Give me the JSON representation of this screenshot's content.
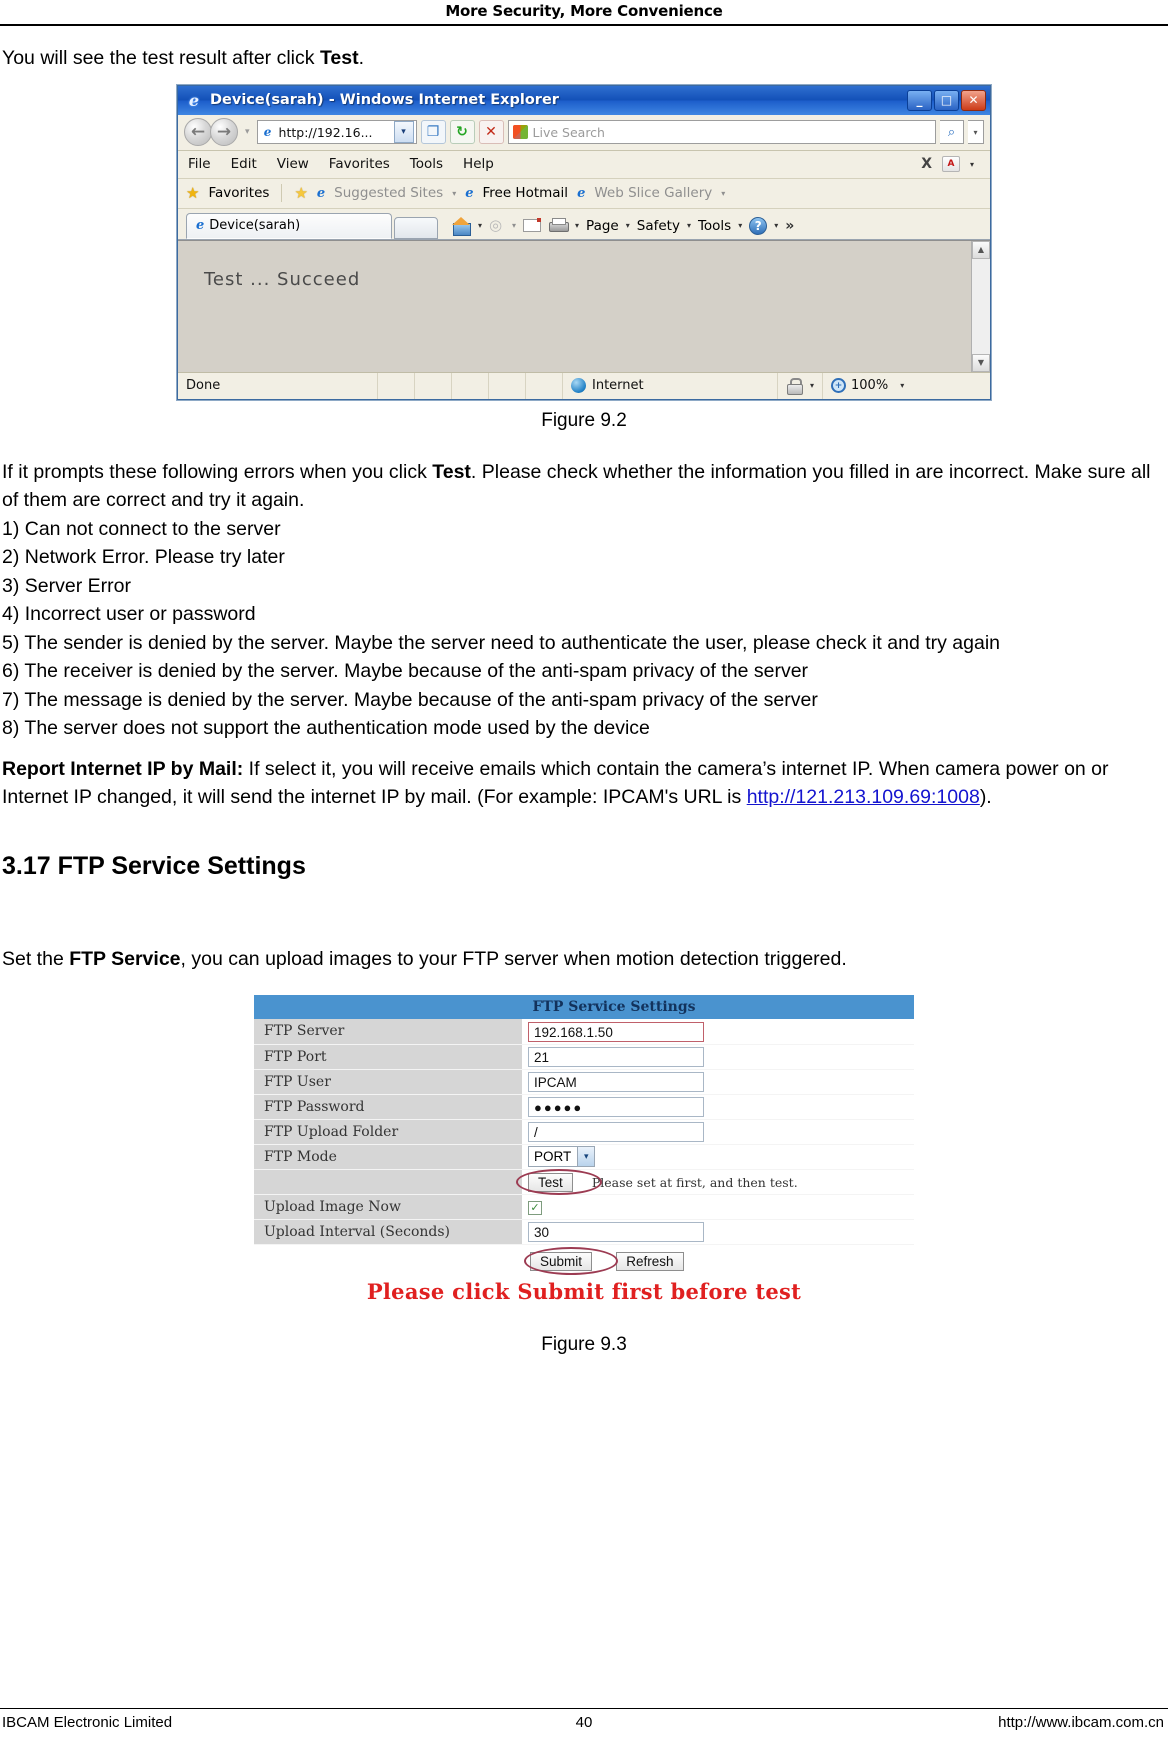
{
  "header": {
    "title": "More Security, More Convenience"
  },
  "intro": {
    "before": "You will see the test result after click ",
    "bold": "Test",
    "after": "."
  },
  "browser": {
    "title": "Device(sarah) - Windows Internet Explorer",
    "window_buttons": {
      "minimize": "_",
      "maximize": "□",
      "close": "✕"
    },
    "address": {
      "url": "http://192.16...",
      "caret": "▾"
    },
    "nav": {
      "back": "←",
      "forward": "→",
      "drop": "▾",
      "compat": "❐",
      "refresh": "↻",
      "stop": "✕"
    },
    "search": {
      "placeholder": "Live Search",
      "go": "⌕",
      "caret": "▾"
    },
    "menu": [
      "File",
      "Edit",
      "View",
      "Favorites",
      "Tools",
      "Help"
    ],
    "menu_right": {
      "x": "X",
      "pdf_caret": "▾"
    },
    "favbar": {
      "favorites": "Favorites",
      "suggested_sites": "Suggested Sites",
      "free_hotmail": "Free Hotmail",
      "web_slice": "Web Slice Gallery",
      "caret": "▾"
    },
    "tab": {
      "label": "Device(sarah)"
    },
    "commandbar": {
      "home_caret": "▾",
      "rss_caret": "▾",
      "print_caret": "▾",
      "page": "Page",
      "safety": "Safety",
      "tools": "Tools",
      "caret": "▾",
      "help": "?",
      "overflow": "»"
    },
    "page_content": "Test  ...  Succeed",
    "scrollbar": {
      "up": "▲",
      "down": "▼"
    },
    "statusbar": {
      "status": "Done",
      "zone": "Internet",
      "zone_caret": "▾",
      "zoom": "100%",
      "zoom_caret": "▾"
    }
  },
  "figure_1_caption": "Figure 9.2",
  "errors": {
    "lead_before": "If it prompts these following errors when you click ",
    "lead_bold": "Test",
    "lead_after": ". Please check whether the information you filled in are incorrect. Make sure all of them are correct and try it again.",
    "items": [
      "1) Can not connect to the server",
      "2) Network Error. Please try later",
      "3) Server Error",
      "4) Incorrect user or password",
      "5) The sender is denied by the server. Maybe the server need to authenticate the user, please check it and try again",
      "6) The receiver is denied by the server. Maybe because of the anti-spam privacy of the server",
      "7) The message is denied by the server. Maybe because of the anti-spam privacy of the server",
      "8) The server does not support the authentication mode used by the device"
    ]
  },
  "report_ip": {
    "label": "Report Internet IP by Mail:",
    "text_before": " If select it, you will receive emails which contain the camera’s internet IP. When camera power on or Internet IP changed, it will send the internet IP by mail. (For example: IPCAM's URL is ",
    "link": "http://121.213.109.69:1008",
    "text_after": ")."
  },
  "section": {
    "title": "3.17 FTP Service Settings",
    "intro_before": "Set the ",
    "intro_bold": "FTP Service",
    "intro_after": ", you can upload images to your FTP server when motion detection triggered."
  },
  "ftp": {
    "header": "FTP Service Settings",
    "rows": [
      {
        "label": "FTP Server",
        "value": "192.168.1.50",
        "type": "text",
        "highlight": true
      },
      {
        "label": "FTP Port",
        "value": "21",
        "type": "text",
        "highlight": false
      },
      {
        "label": "FTP User",
        "value": "IPCAM",
        "type": "text",
        "highlight": false
      },
      {
        "label": "FTP Password",
        "value": "●●●●●",
        "type": "password",
        "highlight": false
      },
      {
        "label": "FTP Upload Folder",
        "value": "/",
        "type": "text",
        "highlight": false
      },
      {
        "label": "FTP Mode",
        "value": "PORT",
        "type": "select",
        "highlight": false
      }
    ],
    "test_row": {
      "label": "",
      "button": "Test",
      "hint": "Please set at first, and then test."
    },
    "upload_now": {
      "label": "Upload Image Now",
      "checked": "✓"
    },
    "upload_interval": {
      "label": "Upload Interval (Seconds)",
      "value": "30"
    },
    "buttons": {
      "submit": "Submit",
      "refresh": "Refresh"
    },
    "annotation": "Please click Submit first before test",
    "select_arrow": "▾"
  },
  "figure_2_caption": "Figure 9.3",
  "footer": {
    "left": "IBCAM Electronic Limited",
    "center": "40",
    "right": "http://www.ibcam.com.cn"
  }
}
